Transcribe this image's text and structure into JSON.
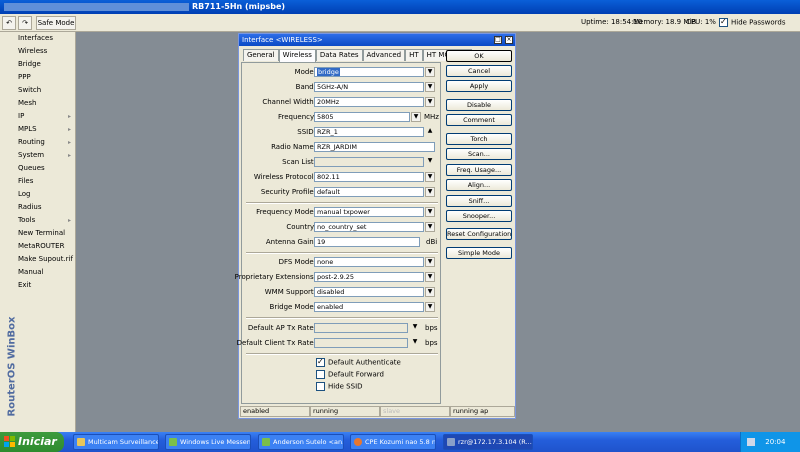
{
  "window": {
    "title": "RB711-5Hn (mipsbe)"
  },
  "toolbar": {
    "undo_icon": "undo-icon",
    "redo_icon": "redo-icon",
    "safe_mode_label": "Safe Mode",
    "uptime": "Uptime: 18:54:10",
    "memory": "Memory: 18.9 MiB",
    "cpu": "CPU: 1%",
    "hide_passwords_label": "Hide Passwords",
    "hide_passwords_checked": true
  },
  "sidebar": {
    "vertical_label": "RouterOS WinBox",
    "items": [
      {
        "label": "Interfaces",
        "arrow": ""
      },
      {
        "label": "Wireless",
        "arrow": ""
      },
      {
        "label": "Bridge",
        "arrow": ""
      },
      {
        "label": "PPP",
        "arrow": ""
      },
      {
        "label": "Switch",
        "arrow": ""
      },
      {
        "label": "Mesh",
        "arrow": ""
      },
      {
        "label": "IP",
        "arrow": "▸"
      },
      {
        "label": "MPLS",
        "arrow": "▸"
      },
      {
        "label": "Routing",
        "arrow": "▸"
      },
      {
        "label": "System",
        "arrow": "▸"
      },
      {
        "label": "Queues",
        "arrow": ""
      },
      {
        "label": "Files",
        "arrow": ""
      },
      {
        "label": "Log",
        "arrow": ""
      },
      {
        "label": "Radius",
        "arrow": ""
      },
      {
        "label": "Tools",
        "arrow": "▸"
      },
      {
        "label": "New Terminal",
        "arrow": ""
      },
      {
        "label": "MetaROUTER",
        "arrow": ""
      },
      {
        "label": "Make Supout.rif",
        "arrow": ""
      },
      {
        "label": "Manual",
        "arrow": ""
      },
      {
        "label": "Exit",
        "arrow": ""
      }
    ]
  },
  "dialog": {
    "title": "Interface <WIRELESS>",
    "tabs": [
      "General",
      "Wireless",
      "Data Rates",
      "Advanced",
      "HT",
      "HT MCS",
      "..."
    ],
    "active_tab": "Wireless",
    "fields": {
      "mode": {
        "label": "Mode:",
        "value": "bridge"
      },
      "band": {
        "label": "Band:",
        "value": "5GHz-A/N"
      },
      "channel_width": {
        "label": "Channel Width:",
        "value": "20MHz"
      },
      "frequency": {
        "label": "Frequency:",
        "value": "5805",
        "unit": "MHz"
      },
      "ssid": {
        "label": "SSID:",
        "value": "RZR_1"
      },
      "radio_name": {
        "label": "Radio Name:",
        "value": "RZR_JARDIM"
      },
      "scan_list": {
        "label": "Scan List:",
        "value": ""
      },
      "wireless_protocol": {
        "label": "Wireless Protocol:",
        "value": "802.11"
      },
      "security_profile": {
        "label": "Security Profile:",
        "value": "default"
      },
      "frequency_mode": {
        "label": "Frequency Mode:",
        "value": "manual txpower"
      },
      "country": {
        "label": "Country:",
        "value": "no_country_set"
      },
      "antenna_gain": {
        "label": "Antenna Gain:",
        "value": "19",
        "unit": "dBi"
      },
      "dfs_mode": {
        "label": "DFS Mode:",
        "value": "none"
      },
      "proprietary_extensions": {
        "label": "Proprietary Extensions:",
        "value": "post-2.9.25"
      },
      "wmm_support": {
        "label": "WMM Support:",
        "value": "disabled"
      },
      "bridge_mode": {
        "label": "Bridge Mode:",
        "value": "enabled"
      },
      "default_ap_tx_rate": {
        "label": "Default AP Tx Rate:",
        "value": "",
        "unit": "bps"
      },
      "default_client_tx_rate": {
        "label": "Default Client Tx Rate:",
        "value": "",
        "unit": "bps"
      }
    },
    "checkboxes": {
      "default_authenticate": {
        "label": "Default Authenticate",
        "checked": true
      },
      "default_forward": {
        "label": "Default Forward",
        "checked": false
      },
      "hide_ssid": {
        "label": "Hide SSID",
        "checked": false
      }
    },
    "buttons": {
      "ok": "OK",
      "cancel": "Cancel",
      "apply": "Apply",
      "disable": "Disable",
      "comment": "Comment",
      "torch": "Torch",
      "scan": "Scan...",
      "freq_usage": "Freq. Usage...",
      "align": "Align...",
      "sniff": "Sniff...",
      "snooper": "Snooper...",
      "reset_configuration": "Reset Configuration",
      "simple_mode": "Simple Mode"
    },
    "status": {
      "cell1": "enabled",
      "cell2": "running",
      "cell3": "slave",
      "cell4": "running ap"
    }
  },
  "taskbar": {
    "start_label": "Iniciar",
    "items": [
      "Multicam Surveillance ...",
      "Windows Live Messen...",
      "Anderson Sutelo <an...",
      "CPE Kozumi nao 5.8 n...",
      "rzr@172.17.3.104 (R..."
    ],
    "clock": "20:04"
  },
  "colors": {
    "titlebar": "#0a5fd8",
    "panel_bg": "#ece9d8",
    "desktop": "#848c94",
    "selection": "#316ac5"
  }
}
